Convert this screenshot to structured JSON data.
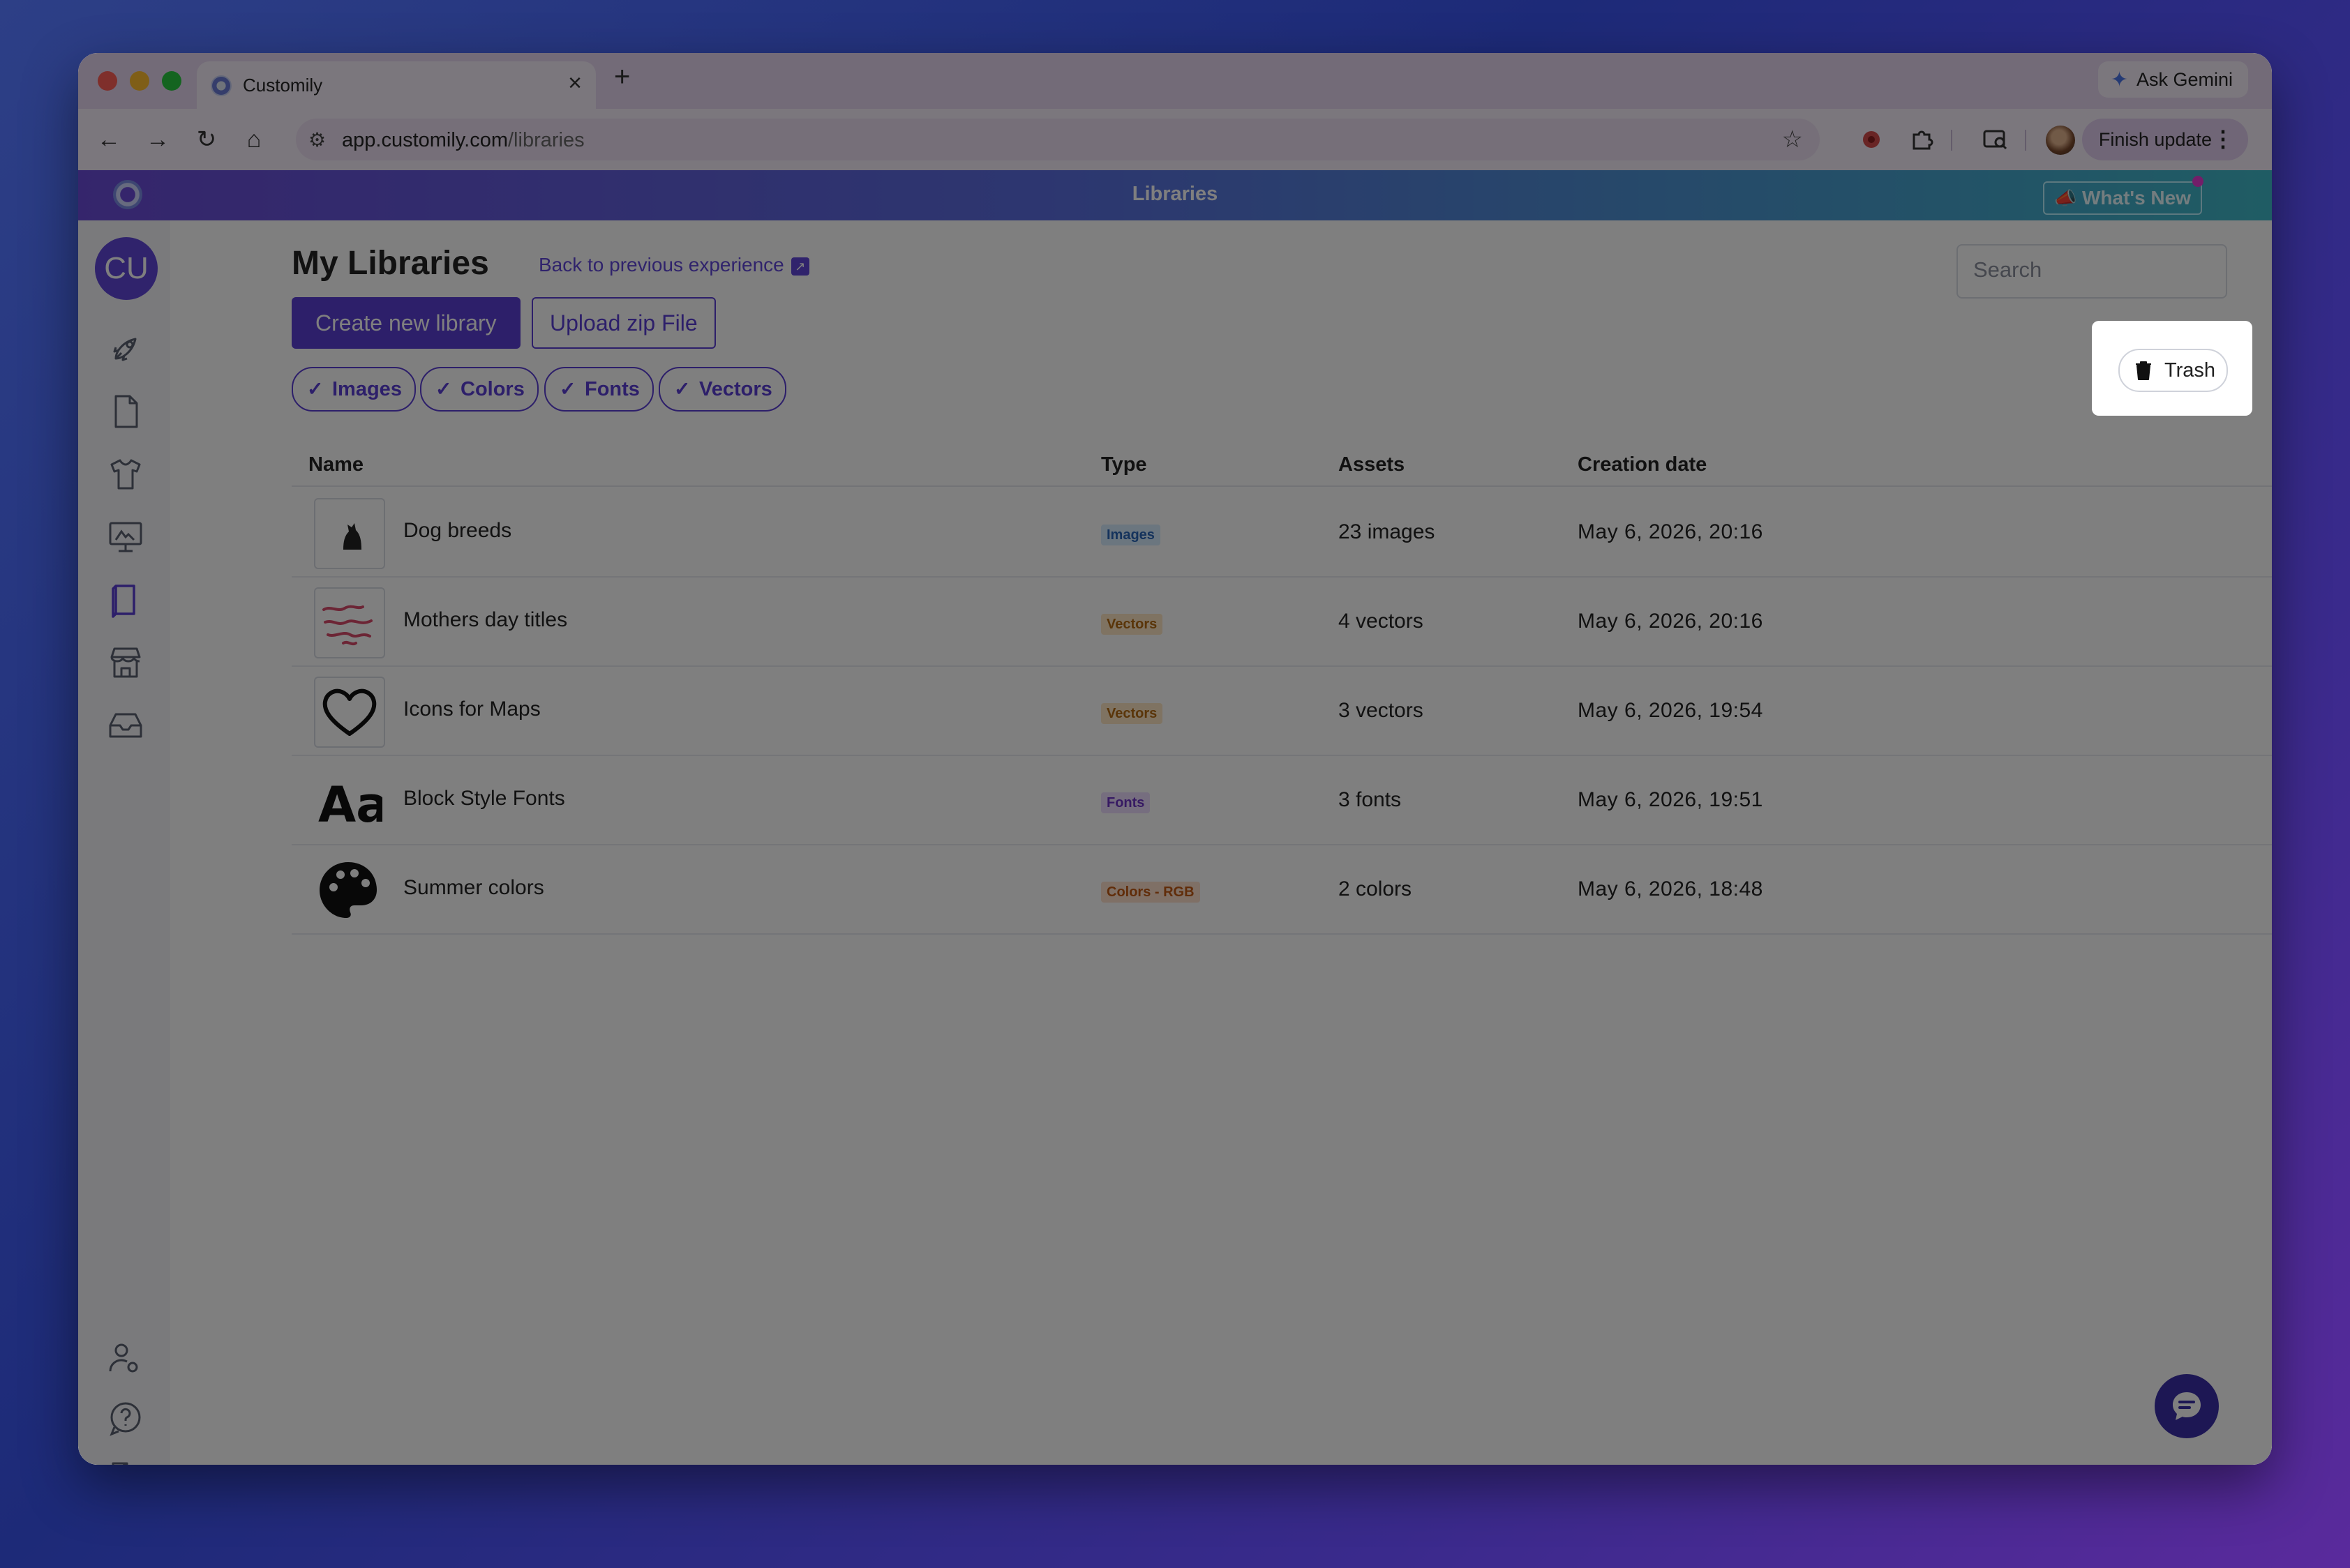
{
  "browser": {
    "tab_title": "Customily",
    "new_tab_label": "+",
    "close_tab_label": "×",
    "ask_gemini": "Ask Gemini",
    "url_domain": "app.customily.com",
    "url_path": "/libraries",
    "finish_update": "Finish update"
  },
  "app": {
    "header_title": "Libraries",
    "whats_new": "What's New",
    "user_initials": "CU"
  },
  "page": {
    "title": "My Libraries",
    "back_link": "Back to previous experience",
    "search_placeholder": "Search",
    "create_button": "Create new library",
    "upload_button": "Upload zip File",
    "filters": [
      "Images",
      "Colors",
      "Fonts",
      "Vectors"
    ],
    "trash_button": "Trash"
  },
  "table": {
    "columns": [
      "Name",
      "Type",
      "Assets",
      "Creation date"
    ],
    "rows": [
      {
        "name": "Dog breeds",
        "type": "Images",
        "assets": "23 images",
        "date": "May 6, 2026, 20:16",
        "thumb": "dog-silhouette-icon"
      },
      {
        "name": "Mothers day titles",
        "type": "Vectors",
        "assets": "4 vectors",
        "date": "May 6, 2026, 20:16",
        "thumb": "mothers-day-lettering"
      },
      {
        "name": "Icons for Maps",
        "type": "Vectors",
        "assets": "3 vectors",
        "date": "May 6, 2026, 19:54",
        "thumb": "heart-icon"
      },
      {
        "name": "Block Style Fonts",
        "type": "Fonts",
        "assets": "3 fonts",
        "date": "May 6, 2026, 19:51",
        "thumb": "font-aa-icon"
      },
      {
        "name": "Summer colors",
        "type": "Colors - RGB",
        "assets": "2 colors",
        "date": "May 6, 2026, 18:48",
        "thumb": "palette-icon"
      }
    ]
  },
  "colors": {
    "accent": "#5b3fd4",
    "overlay": "rgba(0,0,0,0.5)"
  }
}
